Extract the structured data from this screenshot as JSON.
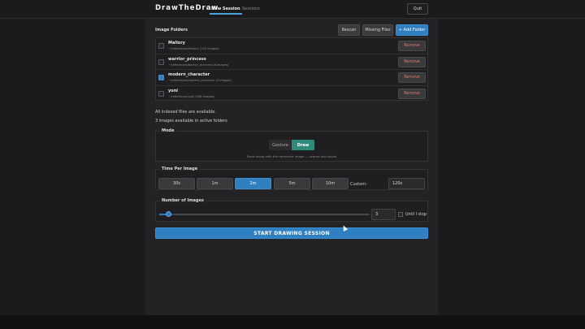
{
  "app": {
    "title": "DrawTheDraw"
  },
  "nav": {
    "tabs": [
      {
        "label": "New Session",
        "active": true
      },
      {
        "label": "Sessions",
        "active": false
      }
    ],
    "quit_label": "Quit"
  },
  "folders": {
    "heading": "Image Folders",
    "rescan_label": "Rescan",
    "missing_label": "Missing Files",
    "add_label": "+ Add Folder",
    "remove_label": "Remove",
    "items": [
      {
        "name": "Mallory",
        "path": "~/references/Mallory  (128 images)",
        "checked": false
      },
      {
        "name": "warrior_princess",
        "path": "~/references/warrior_princess  (8 images)",
        "checked": false
      },
      {
        "name": "modern_character",
        "path": "~/references/modern_character  (3 images)",
        "checked": true
      },
      {
        "name": "yoni",
        "path": "~/references/yoni  (396 images)",
        "checked": false
      }
    ]
  },
  "status": {
    "indexed": "All indexed files are available.",
    "available": "3 images available in active folders"
  },
  "mode": {
    "legend": "Mode",
    "options": [
      "Gesture",
      "Draw"
    ],
    "selected": "Draw",
    "hint": "Draw along with the reference image — scored and saved"
  },
  "time": {
    "legend": "Time Per Image",
    "options": [
      "30s",
      "1m",
      "2m",
      "5m",
      "10m"
    ],
    "selected": "2m",
    "custom_label": "Custom:",
    "custom_value": "120s"
  },
  "count": {
    "legend": "Number of Images",
    "value": "3",
    "slider_fraction": 0.03,
    "until_label": "Until I stop",
    "until_checked": false
  },
  "start_label": "START DRAWING SESSION",
  "colors": {
    "accent": "#2f7fc1",
    "mode_on": "#2e8a7a",
    "remove_text": "#e07a6a"
  }
}
